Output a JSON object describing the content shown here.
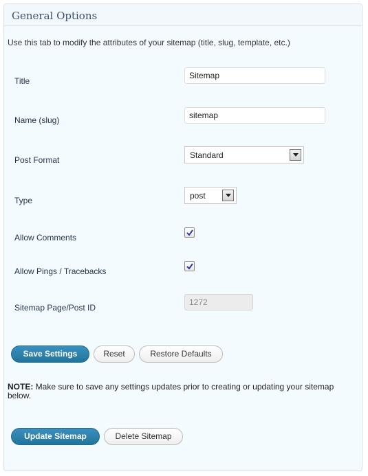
{
  "panel": {
    "title": "General Options"
  },
  "intro": "Use this tab to modify the attributes of your sitemap (title, slug, template, etc.)",
  "fields": {
    "title": {
      "label": "Title",
      "value": "Sitemap"
    },
    "slug": {
      "label": "Name (slug)",
      "value": "sitemap"
    },
    "post_format": {
      "label": "Post Format",
      "value": "Standard"
    },
    "type": {
      "label": "Type",
      "value": "post"
    },
    "allow_comments": {
      "label": "Allow Comments",
      "checked": true
    },
    "allow_pings": {
      "label": "Allow Pings / Tracebacks",
      "checked": true
    },
    "page_id": {
      "label": "Sitemap Page/Post ID",
      "value": "1272"
    }
  },
  "buttons": {
    "save": "Save Settings",
    "reset": "Reset",
    "restore": "Restore Defaults",
    "update": "Update Sitemap",
    "delete": "Delete Sitemap"
  },
  "note": {
    "label": "NOTE:",
    "text": " Make sure to save any settings updates prior to creating or updating your sitemap below."
  },
  "colors": {
    "primary_button": "#21759b",
    "label_text": "#21344a",
    "panel_bg": "#f4fbfe"
  }
}
